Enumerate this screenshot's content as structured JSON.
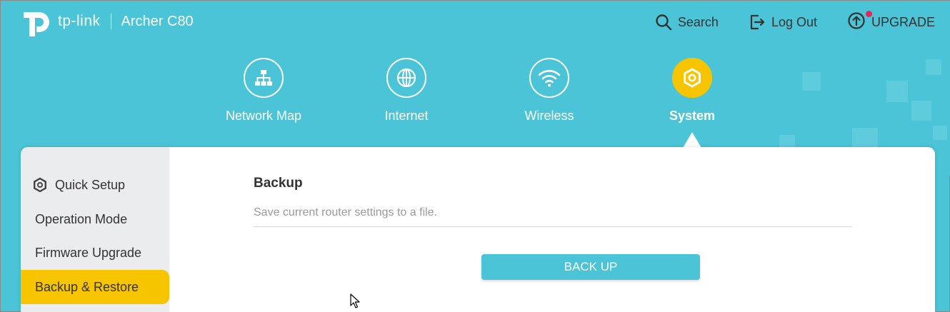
{
  "header": {
    "brand": "tp-link",
    "model": "Archer C80",
    "links": {
      "search": "Search",
      "logout": "Log Out",
      "upgrade": "UPGRADE"
    }
  },
  "nav": {
    "tabs": [
      {
        "label": "Network Map",
        "icon": "network-map-icon",
        "active": false
      },
      {
        "label": "Internet",
        "icon": "globe-icon",
        "active": false
      },
      {
        "label": "Wireless",
        "icon": "wifi-icon",
        "active": false
      },
      {
        "label": "System",
        "icon": "gear-icon",
        "active": true
      }
    ]
  },
  "sidebar": {
    "items": [
      {
        "label": "Quick Setup",
        "icon": "gear-icon",
        "active": false
      },
      {
        "label": "Operation Mode",
        "active": false
      },
      {
        "label": "Firmware Upgrade",
        "active": false
      },
      {
        "label": "Backup & Restore",
        "active": true
      }
    ]
  },
  "main": {
    "section_title": "Backup",
    "section_desc": "Save current router settings to a file.",
    "backup_button": "BACK UP"
  },
  "colors": {
    "header_bg": "#4ac4d6",
    "accent_yellow": "#f7c500",
    "sidebar_bg": "#ebeced",
    "button_bg": "#4ac4d6",
    "upgrade_dot": "#e4265a"
  }
}
